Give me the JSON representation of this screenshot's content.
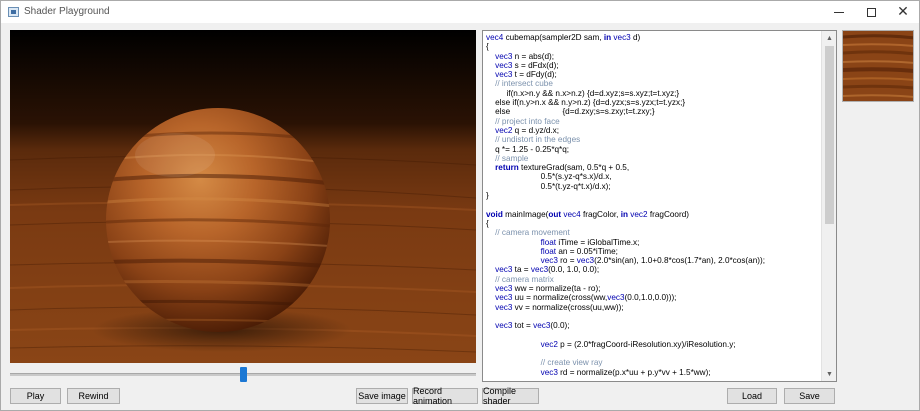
{
  "window": {
    "title": "Shader Playground",
    "icon": "app-window-icon",
    "controls": [
      "minimize-icon",
      "maximize-icon",
      "close-icon"
    ]
  },
  "render": {
    "description_icon": "wood-sphere-render",
    "colors": {
      "sky": "#000000",
      "wood_dark": "#5a2508",
      "wood_light": "#c46a28"
    }
  },
  "timeline": {
    "position": 0.5
  },
  "buttons": {
    "play": "Play",
    "rewind": "Rewind",
    "save_image": "Save image",
    "record_animation": "Record animation",
    "compile_shader": "Compile shader",
    "load": "Load",
    "save": "Save"
  },
  "code_lines": [
    "vec4 cubemap(sampler2D sam, in vec3 d)",
    "{",
    "    vec3 n = abs(d);",
    "    vec3 s = dFdx(d);",
    "    vec3 t = dFdy(d);",
    "    // intersect cube",
    "         if(n.x>n.y && n.x>n.z) {d=d.xyz;s=s.xyz;t=t.xyz;}",
    "    else if(n.y>n.x && n.y>n.z) {d=d.yzx;s=s.yzx;t=t.yzx;}",
    "    else                       {d=d.zxy;s=s.zxy;t=t.zxy;}",
    "    // project into face",
    "    vec2 q = d.yz/d.x;",
    "    // undistort in the edges",
    "    q *= 1.25 - 0.25*q*q;",
    "    // sample",
    "    return textureGrad(sam, 0.5*q + 0.5,",
    "                        0.5*(s.yz-q*s.x)/d.x,",
    "                        0.5*(t.yz-q*t.x)/d.x);",
    "}",
    "",
    "void mainImage(out vec4 fragColor, in vec2 fragCoord)",
    "{",
    "    // camera movement",
    "                        float iTime = iGlobalTime.x;",
    "                        float an = 0.05*iTime;",
    "                        vec3 ro = vec3(2.0*sin(an), 1.0+0.8*cos(1.7*an), 2.0*cos(an));",
    "    vec3 ta = vec3(0.0, 1.0, 0.0);",
    "    // camera matrix",
    "    vec3 ww = normalize(ta - ro);",
    "    vec3 uu = normalize(cross(ww,vec3(0.0,1.0,0.0)));",
    "    vec3 vv = normalize(cross(uu,ww));",
    "",
    "    vec3 tot = vec3(0.0);",
    "",
    "                        vec2 p = (2.0*fragCoord-iResolution.xy)/iResolution.y;",
    "",
    "                        // create view ray",
    "                        vec3 rd = normalize(p.x*uu + p.y*vv + 1.5*ww);"
  ],
  "syntax_colors": {
    "keyword": "#0000b0",
    "comment": "#7c92ad",
    "text": "#000000"
  },
  "scrollbar": {
    "position": 0.0,
    "visible_fraction": 0.55
  },
  "texture_channel": {
    "icon": "wood-texture-thumbnail"
  }
}
